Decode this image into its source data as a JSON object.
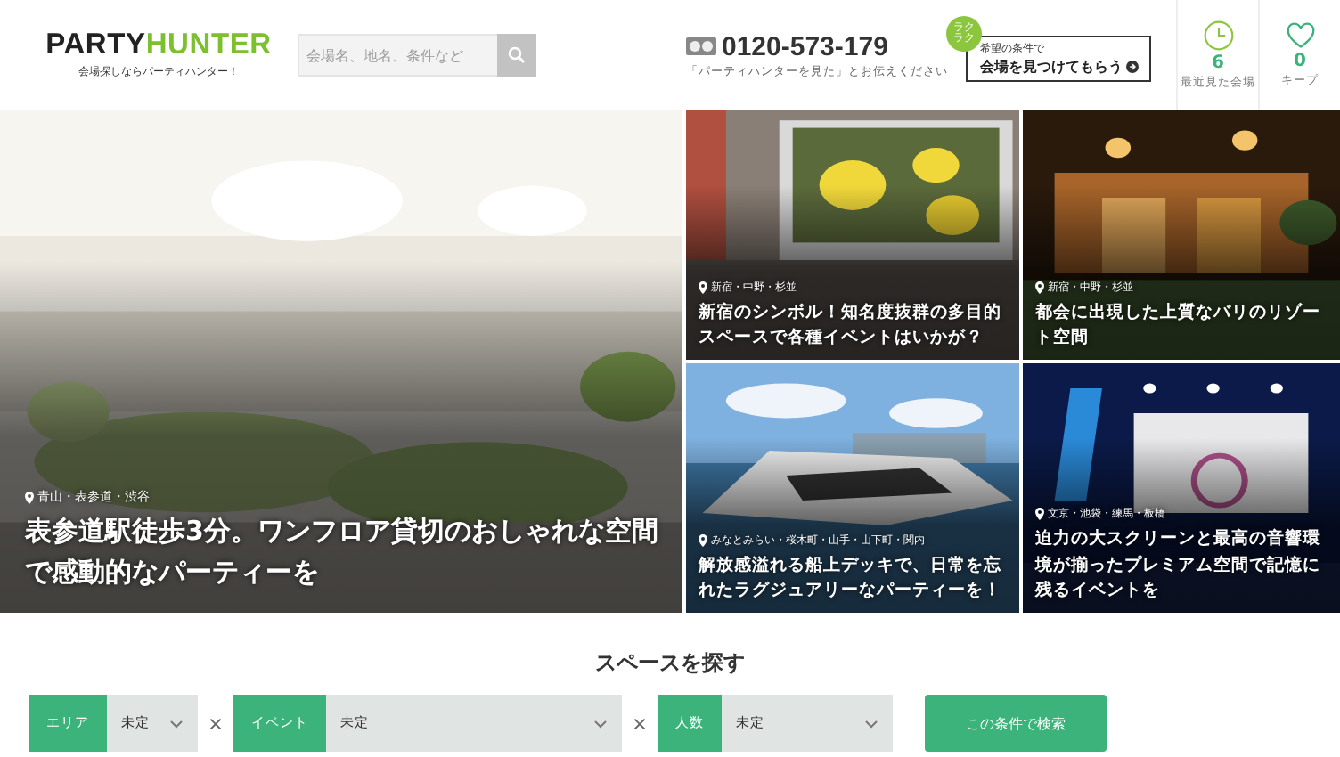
{
  "header": {
    "logo": {
      "part_1": "PARTY",
      "part_2": "HUNTER"
    },
    "tagline": "会場探しならパーティハンター！",
    "search": {
      "placeholder": "会場名、地名、条件など"
    },
    "phone": {
      "number": "0120-573-179",
      "note": "「パーティハンターを見た」とお伝えください"
    },
    "concierge": {
      "badge": "ラクラク",
      "caption": "希望の条件で",
      "label": "会場を見つけてもらう"
    },
    "counters": [
      {
        "kind": "recent",
        "count": "6",
        "label": "最近見た会場"
      },
      {
        "kind": "keep",
        "count": "0",
        "label": "キープ"
      }
    ]
  },
  "features": [
    {
      "area": "青山・表参道・渋谷",
      "title": "表参道駅徒歩3分。ワンフロア貸切のおしゃれな空間で感動的なパーティーを"
    },
    {
      "area": "新宿・中野・杉並",
      "title": "新宿のシンボル！知名度抜群の多目的スペースで各種イベントはいかが？"
    },
    {
      "area": "新宿・中野・杉並",
      "title": "都会に出現した上質なバリのリゾート空間"
    },
    {
      "area": "みなとみらい・桜木町・山手・山下町・関内",
      "title": "解放感溢れる船上デッキで、日常を忘れたラグジュアリーなパーティーを！"
    },
    {
      "area": "文京・池袋・練馬・板橋",
      "title": "迫力の大スクリーンと最高の音響環境が揃ったプレミアム空間で記憶に残るイベントを"
    }
  ],
  "space_search": {
    "title": "スペースを探す",
    "separator": "×",
    "filters": [
      {
        "label": "エリア",
        "value": "未定"
      },
      {
        "label": "イベント",
        "value": "未定"
      },
      {
        "label": "人数",
        "value": "未定"
      }
    ],
    "button": "この条件で検索"
  }
}
